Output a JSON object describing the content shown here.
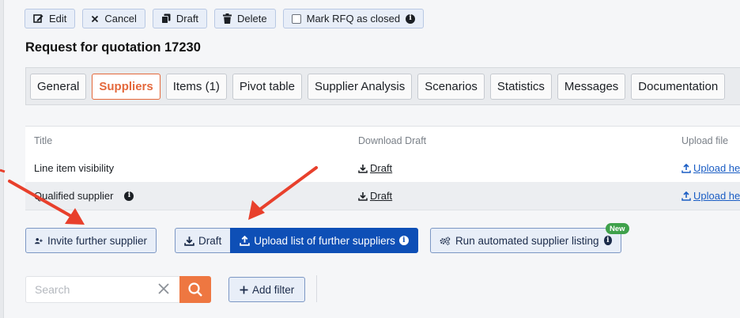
{
  "toolbar": {
    "edit_label": "Edit",
    "cancel_label": "Cancel",
    "draft_label": "Draft",
    "delete_label": "Delete",
    "mark_closed_label": "Mark RFQ as closed"
  },
  "page": {
    "title": "Request for quotation 17230"
  },
  "tabs": [
    {
      "label": "General"
    },
    {
      "label": "Suppliers",
      "active": true
    },
    {
      "label": "Items (1)"
    },
    {
      "label": "Pivot table"
    },
    {
      "label": "Supplier Analysis"
    },
    {
      "label": "Scenarios"
    },
    {
      "label": "Statistics"
    },
    {
      "label": "Messages"
    },
    {
      "label": "Documentation"
    }
  ],
  "table": {
    "headers": [
      "Title",
      "Download Draft",
      "Upload file"
    ],
    "rows": [
      {
        "title": "Line item visibility",
        "download": "Draft",
        "upload": "Upload he"
      },
      {
        "title": "Qualified supplier",
        "download": "Draft",
        "upload": "Upload he"
      }
    ]
  },
  "actions": {
    "invite_label": "Invite further supplier",
    "draft_label": "Draft",
    "upload_list_label": "Upload list of further suppliers",
    "run_listing_label": "Run automated supplier listing",
    "new_badge": "New"
  },
  "search": {
    "placeholder": "Search",
    "value": ""
  },
  "filter": {
    "add_label": "Add filter"
  },
  "colors": {
    "accent": "#e4683b",
    "primary_blue": "#0e4fb6",
    "link_blue": "#1a5dc4",
    "annotation_arrow": "#e8402c",
    "new_badge_green": "#3fa14b"
  },
  "icons": [
    "edit-icon",
    "close-icon",
    "copy-icon",
    "trash-icon",
    "info-icon",
    "download-icon",
    "upload-icon",
    "add-user-icon",
    "gears-icon",
    "search-icon",
    "plus-icon"
  ]
}
